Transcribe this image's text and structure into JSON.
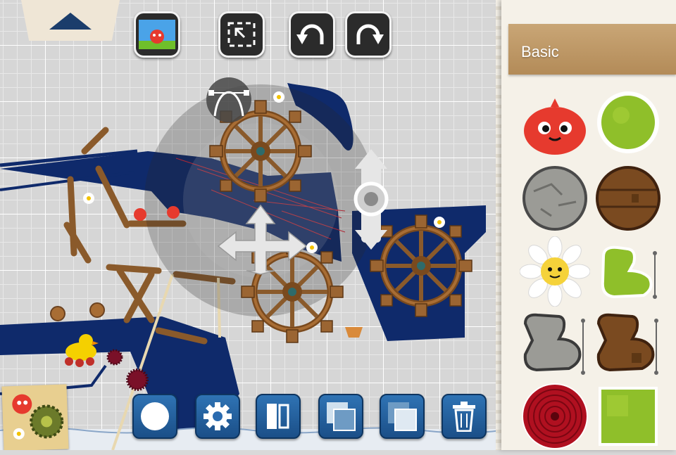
{
  "toolbar": {
    "top_buttons": [
      {
        "name": "level-preview-button",
        "icon": "level-thumbnail-icon"
      },
      {
        "name": "fit-view-button",
        "icon": "fit-to-screen-icon"
      },
      {
        "name": "undo-button",
        "icon": "undo-arrow-icon"
      },
      {
        "name": "redo-button",
        "icon": "redo-arrow-icon"
      }
    ],
    "collapse_icon": "triangle-up-icon",
    "bottom_buttons": [
      {
        "name": "record-button",
        "icon": "circle-icon"
      },
      {
        "name": "settings-button",
        "icon": "gear-icon"
      },
      {
        "name": "split-view-button",
        "icon": "split-panel-icon"
      },
      {
        "name": "layer-back-button",
        "icon": "layers-icon"
      },
      {
        "name": "layer-front-button",
        "icon": "layers-icon"
      },
      {
        "name": "delete-button",
        "icon": "trash-icon"
      }
    ]
  },
  "palette": {
    "category": "Basic",
    "items": [
      {
        "name": "red-bird-piece",
        "icon": "red-bird-icon"
      },
      {
        "name": "grass-ball-piece",
        "icon": "grass-circle-icon"
      },
      {
        "name": "stone-ball-piece",
        "icon": "stone-circle-icon"
      },
      {
        "name": "wood-ball-piece",
        "icon": "wood-circle-icon"
      },
      {
        "name": "daisy-piece",
        "icon": "daisy-icon"
      },
      {
        "name": "grass-shape-piece",
        "icon": "grass-blob-icon"
      },
      {
        "name": "stone-shape-piece",
        "icon": "stone-blob-icon"
      },
      {
        "name": "wood-shape-piece",
        "icon": "wood-blob-icon"
      },
      {
        "name": "red-target-piece",
        "icon": "red-target-icon"
      },
      {
        "name": "grass-square-piece",
        "icon": "grass-square-icon"
      }
    ]
  },
  "colors": {
    "water": "#0f2a6b",
    "wood": "#8a5a2b",
    "button_blue": "#2a6bb0",
    "grass": "#8fbf2a",
    "bird_red": "#e63a2e"
  }
}
